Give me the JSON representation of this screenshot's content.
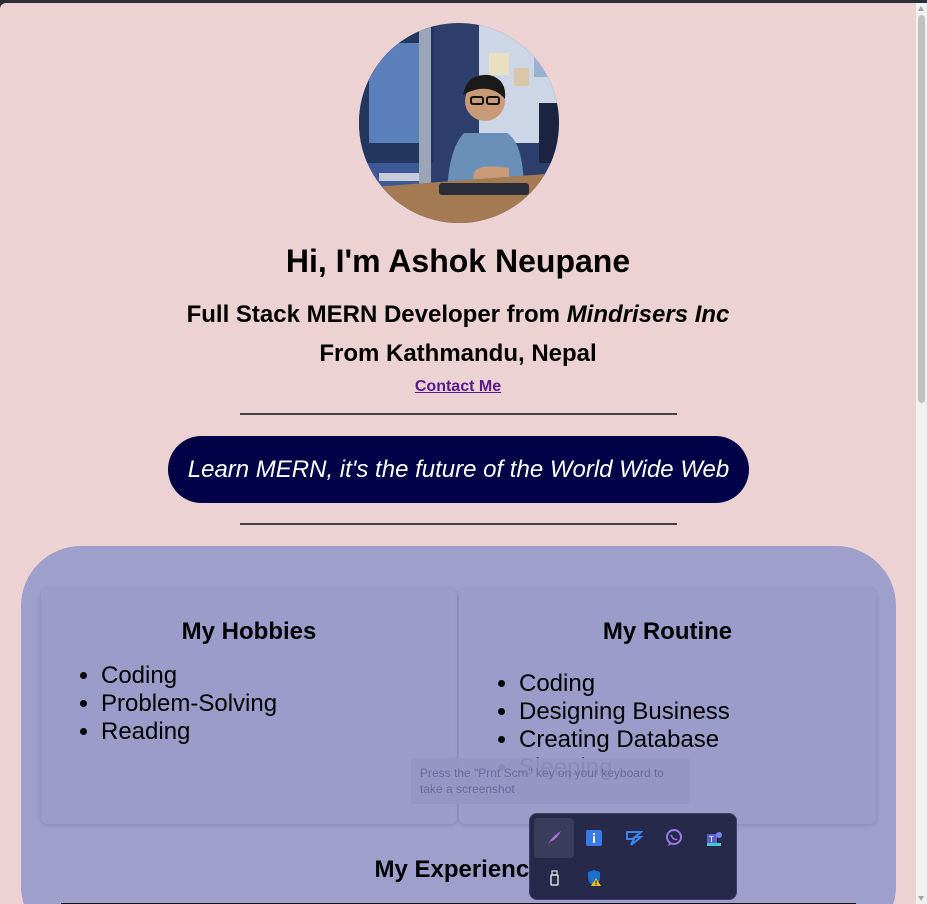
{
  "profile": {
    "greeting": "Hi, I'm Ashok Neupane",
    "role_prefix": "Full Stack MERN Developer from ",
    "company": "Mindrisers Inc",
    "location": "From Kathmandu, Nepal",
    "contact_link": "Contact Me",
    "avatar_alt": "Profile photo"
  },
  "banner": {
    "text": "Learn MERN, it's the future of the World Wide Web"
  },
  "hobbies": {
    "title": "My Hobbies",
    "items": [
      "Coding",
      "Problem-Solving",
      "Reading"
    ]
  },
  "routine": {
    "title": "My Routine",
    "items": [
      "Coding",
      "Designing Business",
      "Creating Database",
      "Sleeping"
    ]
  },
  "experience": {
    "title": "My Experience"
  },
  "tooltip": {
    "text": "Press the \"Prnt Scrn\" key on your keyboard to take a screenshot"
  },
  "tray": {
    "icons": [
      "feather-icon",
      "info-icon",
      "vpn-shield-icon",
      "viber-icon",
      "teams-icon",
      "usb-drive-icon",
      "defender-warning-icon"
    ]
  },
  "colors": {
    "page_bg": "#edd2d4",
    "banner_bg": "#000147",
    "section_bg": "#9f9fcb",
    "link": "#551a8b"
  }
}
